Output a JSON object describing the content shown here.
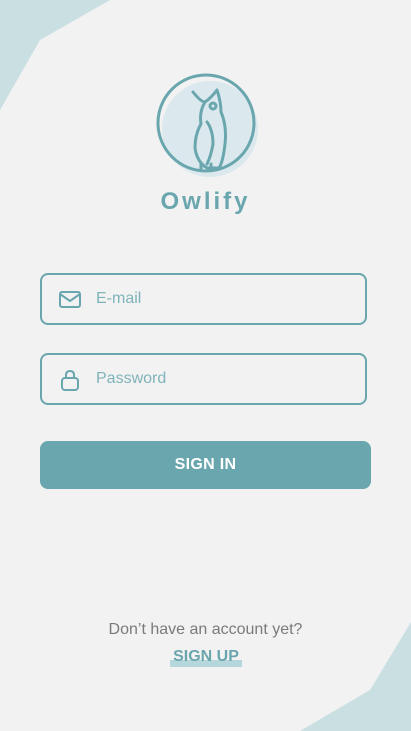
{
  "app": {
    "name": "Owlify"
  },
  "form": {
    "email": {
      "placeholder": "E-mail",
      "value": ""
    },
    "password": {
      "placeholder": "Password",
      "value": ""
    },
    "signin_label": "SIGN IN"
  },
  "footer": {
    "prompt": "Don’t have an account yet?",
    "signup_label": "SIGN UP"
  },
  "colors": {
    "accent": "#6aa6ad",
    "accent_light": "#dbe9ee",
    "decor": "#c9dfe1",
    "background": "#f2f2f2"
  },
  "icons": [
    "owl-logo-icon",
    "envelope-icon",
    "lock-icon"
  ]
}
